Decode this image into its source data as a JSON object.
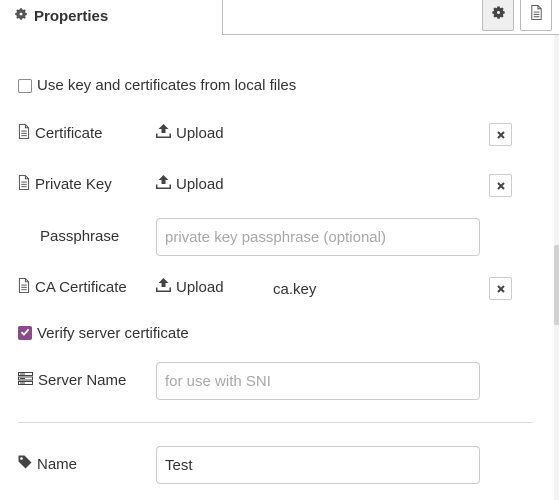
{
  "header": {
    "title": "Properties",
    "icon": "gear-icon"
  },
  "tabs": [
    {
      "icon": "gear-icon",
      "active": true
    },
    {
      "icon": "document-icon",
      "active": false
    }
  ],
  "form": {
    "local_files_label": "Use key and certificates from local files",
    "local_files_checked": false,
    "certificate": {
      "label": "Certificate",
      "upload_label": "Upload"
    },
    "private_key": {
      "label": "Private Key",
      "upload_label": "Upload"
    },
    "passphrase": {
      "label": "Passphrase",
      "placeholder": "private key passphrase (optional)",
      "value": ""
    },
    "ca_certificate": {
      "label": "CA Certificate",
      "upload_label": "Upload",
      "filename": "ca.key"
    },
    "verify_label": "Verify server certificate",
    "verify_checked": true,
    "server_name": {
      "label": "Server Name",
      "placeholder": "for use with SNI",
      "value": ""
    },
    "name": {
      "label": "Name",
      "value": "Test"
    }
  },
  "colors": {
    "accent": "#8c4a8c",
    "border": "#cccccc",
    "placeholder": "#a8a8a8",
    "text": "#333333"
  }
}
